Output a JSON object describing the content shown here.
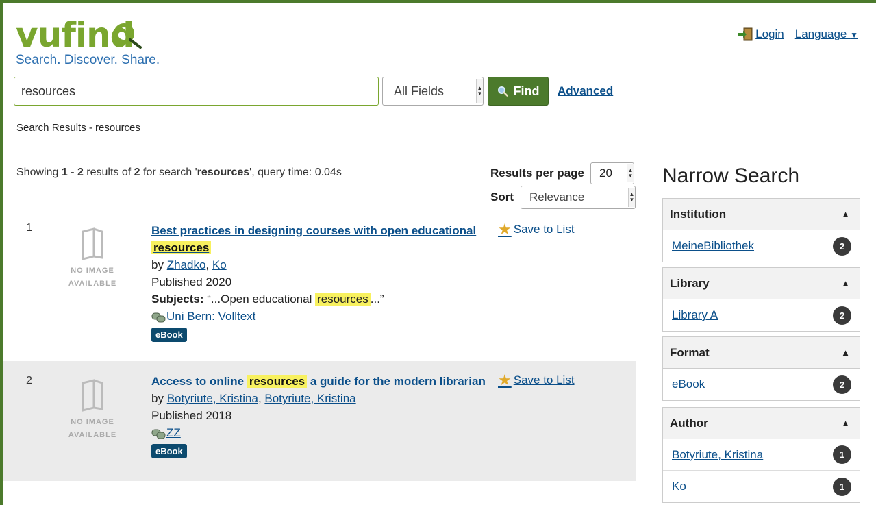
{
  "header": {
    "logo_text": "vufind",
    "tagline": "Search. Discover. Share.",
    "login_label": "Login",
    "language_label": "Language"
  },
  "search": {
    "query": "resources",
    "type_selected": "All Fields",
    "find_label": "Find",
    "advanced_label": "Advanced"
  },
  "breadcrumb": "Search Results - resources",
  "summary": {
    "prefix": "Showing ",
    "range": "1 - 2",
    "mid1": " results of ",
    "total": "2",
    "mid2": " for search '",
    "query": "resources",
    "suffix": "', query time: 0.04s"
  },
  "controls": {
    "rpp_label": "Results per page",
    "rpp_value": "20",
    "sort_label": "Sort",
    "sort_value": "Relevance"
  },
  "thumb_text": {
    "line1": "NO IMAGE",
    "line2": "AVAILABLE"
  },
  "results": [
    {
      "num": "1",
      "title_pre": "Best practices in designing courses with open educational",
      "title_hl": "resources",
      "by_label": "by",
      "author1": "Zhadko",
      "author2": "Ko",
      "published": "Published 2020",
      "subjects_label": "Subjects:",
      "subjects_pre": "“...Open educational",
      "subjects_hl": "resources",
      "subjects_post": "...”",
      "link_text": "Uni Bern: Volltext",
      "format": "eBook",
      "save_label": "Save to List"
    },
    {
      "num": "2",
      "title_pre": "Access to online",
      "title_hl": "resources",
      "title_post": "a guide for the modern librarian",
      "by_label": "by",
      "author1": "Botyriute, Kristina",
      "author2": "Botyriute, Kristina",
      "published": "Published 2018",
      "link_text": "ZZ",
      "format": "eBook",
      "save_label": "Save to List"
    }
  ],
  "sidebar": {
    "title": "Narrow Search",
    "facets": [
      {
        "name": "Institution",
        "items": [
          {
            "label": "MeineBibliothek",
            "count": "2"
          }
        ]
      },
      {
        "name": "Library",
        "items": [
          {
            "label": "Library A",
            "count": "2"
          }
        ]
      },
      {
        "name": "Format",
        "items": [
          {
            "label": "eBook",
            "count": "2"
          }
        ]
      },
      {
        "name": "Author",
        "items": [
          {
            "label": "Botyriute, Kristina",
            "count": "1"
          },
          {
            "label": "Ko",
            "count": "1"
          }
        ]
      }
    ]
  },
  "colors": {
    "brand_green": "#4c7a2c",
    "link_blue": "#0b4f8a",
    "highlight": "#f8f15f",
    "badge": "#0c4a6e"
  }
}
